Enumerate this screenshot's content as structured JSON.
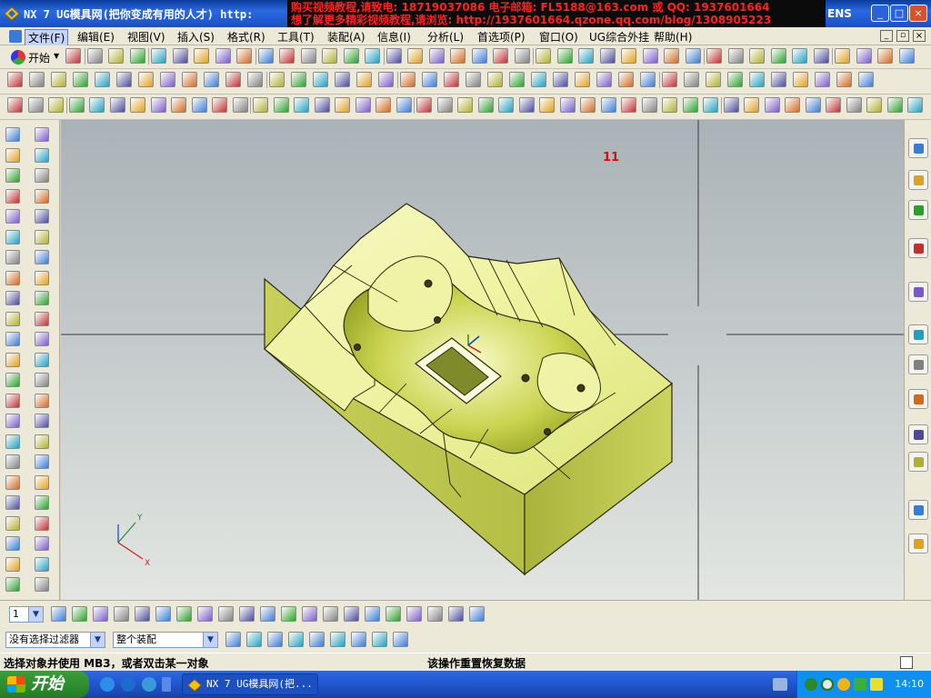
{
  "window": {
    "title": "NX 7 UG模具网(把你变成有用的人才) http:",
    "brand_fragment": "ENS",
    "promo_line1": "购买视频教程,请致电: 18719037086 电子邮箱: FL5188@163.com 或 QQ: 1937601664",
    "promo_line2": "想了解更多精彩视频教程,请浏览: http://1937601664.qzone.qq.com/blog/1308905223",
    "minimize_glyph": "_",
    "maximize_glyph": "□",
    "close_glyph": "×"
  },
  "menubar": {
    "items": [
      {
        "label": "文件(F)"
      },
      {
        "label": "编辑(E)"
      },
      {
        "label": "视图(V)"
      },
      {
        "label": "插入(S)"
      },
      {
        "label": "格式(R)"
      },
      {
        "label": "工具(T)"
      },
      {
        "label": "装配(A)"
      },
      {
        "label": "信息(I)"
      },
      {
        "label": "分析(L)"
      },
      {
        "label": "首选项(P)"
      },
      {
        "label": "窗口(O)"
      },
      {
        "label": "UG综合外挂"
      },
      {
        "label": "帮助(H)"
      }
    ]
  },
  "standard_toolbar": {
    "start_label": "开始"
  },
  "viewport": {
    "overlay_label": "11",
    "triad_x": "X",
    "triad_y": "Y"
  },
  "bottom_toolbar": {
    "layer_value": "1"
  },
  "selection_bar": {
    "filter_value": "没有选择过滤器",
    "scope_value": "整个装配"
  },
  "status": {
    "prompt": "选择对象并使用 MB3，或者双击某一对象",
    "message": "该操作重置恢复数据"
  },
  "taskbar": {
    "start_label": "开始",
    "task_item_label": "NX 7 UG模具网(把...",
    "clock": "14:10"
  },
  "colors": {
    "part_light": "#f4f7b0",
    "part_mid": "#dfe67a",
    "part_dark": "#b9c24d",
    "part_shadow": "#8f9a2a",
    "viewport_top": "#a9b2b6",
    "viewport_bottom": "#e3e6e2",
    "titlebar_blue": "#1a4fc4",
    "promo_red": "#ff2020"
  }
}
